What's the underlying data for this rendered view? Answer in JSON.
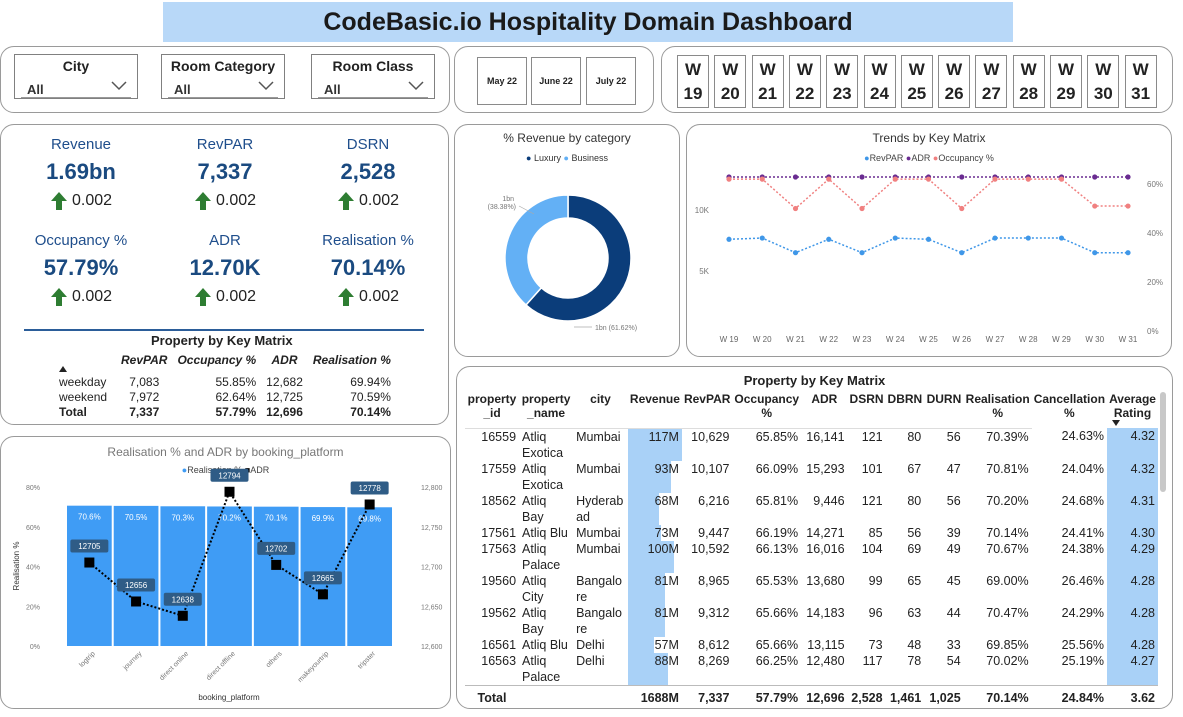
{
  "title": "CodeBasic.io  Hospitality Domain Dashboard",
  "slicers": [
    {
      "label": "City",
      "value": "All"
    },
    {
      "label": "Room Category",
      "value": "All"
    },
    {
      "label": "Room Class",
      "value": "All"
    }
  ],
  "months": [
    "May 22",
    "June 22",
    "July 22"
  ],
  "weeks": [
    {
      "w": "W",
      "n": "19"
    },
    {
      "w": "W",
      "n": "20"
    },
    {
      "w": "W",
      "n": "21"
    },
    {
      "w": "W",
      "n": "22"
    },
    {
      "w": "W",
      "n": "23"
    },
    {
      "w": "W",
      "n": "24"
    },
    {
      "w": "W",
      "n": "25"
    },
    {
      "w": "W",
      "n": "26"
    },
    {
      "w": "W",
      "n": "27"
    },
    {
      "w": "W",
      "n": "28"
    },
    {
      "w": "W",
      "n": "29"
    },
    {
      "w": "W",
      "n": "30"
    },
    {
      "w": "W",
      "n": "31"
    }
  ],
  "kpis": [
    {
      "label": "Revenue",
      "value": "1.69bn",
      "delta": "0.002"
    },
    {
      "label": "RevPAR",
      "value": "7,337",
      "delta": "0.002"
    },
    {
      "label": "DSRN",
      "value": "2,528",
      "delta": "0.002"
    },
    {
      "label": "Occupancy %",
      "value": "57.79%",
      "delta": "0.002"
    },
    {
      "label": "ADR",
      "value": "12.70K",
      "delta": "0.002"
    },
    {
      "label": "Realisation %",
      "value": "70.14%",
      "delta": "0.002"
    }
  ],
  "colors": {
    "accent": "#1f4e8c",
    "arrow": "#2e7d32",
    "luxury": "#0b3d7a",
    "business": "#63b0f5",
    "revpar": "#3f97e8",
    "adr": "#6a2c91",
    "occupancy": "#f08080",
    "bar": "#3f9cf5",
    "title_bg": "#b8d8f8"
  },
  "small_matrix": {
    "title": "Property by Key Matrix",
    "headers": [
      "RevPAR",
      "Occupancy %",
      "ADR",
      "Realisation %"
    ],
    "rows": [
      {
        "name": "weekday",
        "cells": [
          "7,083",
          "55.85%",
          "12,682",
          "69.94%"
        ]
      },
      {
        "name": "weekend",
        "cells": [
          "7,972",
          "62.64%",
          "12,725",
          "70.59%"
        ]
      }
    ],
    "total": {
      "name": "Total",
      "cells": [
        "7,337",
        "57.79%",
        "12,696",
        "70.14%"
      ]
    }
  },
  "donut": {
    "title": "% Revenue by category",
    "legend": [
      "Luxury",
      "Business"
    ],
    "label_business_1": "1bn",
    "label_business_2": "(38.38%)",
    "label_luxury": "1bn (61.62%)"
  },
  "trends": {
    "title": "Trends by Key Matrix",
    "legend": [
      "RevPAR",
      "ADR",
      "Occupancy %"
    ],
    "left_ticks": [
      "10K",
      "5K"
    ],
    "right_ticks": [
      "60%",
      "40%",
      "20%",
      "0%"
    ]
  },
  "platform_chart": {
    "title": "Realisation % and ADR by booking_platform",
    "legend": [
      "Realisation %",
      "ADR"
    ],
    "ylabel": "Realisation %",
    "xlabel": "booking_platform",
    "left_ticks": [
      "80%",
      "60%",
      "40%",
      "20%",
      "0%"
    ],
    "right_ticks": [
      "12,800",
      "12,750",
      "12,700",
      "12,650",
      "12,600"
    ]
  },
  "chart_data": [
    {
      "type": "pie",
      "title": "% Revenue by category",
      "categories": [
        "Luxury",
        "Business"
      ],
      "values": [
        61.62,
        38.38
      ]
    },
    {
      "type": "line",
      "title": "Trends by Key Matrix",
      "x": [
        "W 19",
        "W 20",
        "W 21",
        "W 22",
        "W 23",
        "W 24",
        "W 25",
        "W 26",
        "W 27",
        "W 28",
        "W 29",
        "W 30",
        "W 31"
      ],
      "series": [
        {
          "name": "RevPAR",
          "axis": "left",
          "values": [
            7600,
            7700,
            6500,
            7600,
            6500,
            7700,
            7600,
            6500,
            7700,
            7700,
            7700,
            6500,
            6500
          ]
        },
        {
          "name": "ADR",
          "axis": "left",
          "values": [
            12700,
            12700,
            12700,
            12700,
            12700,
            12700,
            12700,
            12700,
            12700,
            12700,
            12700,
            12700,
            12700
          ]
        },
        {
          "name": "Occupancy %",
          "axis": "right",
          "values": [
            62,
            62,
            50,
            62,
            50,
            62,
            62,
            50,
            62,
            62,
            62,
            51,
            51
          ]
        }
      ],
      "ylim_left": [
        0,
        14500
      ],
      "ylim_right": [
        0,
        65
      ],
      "grid": false,
      "legend": "top-center"
    },
    {
      "type": "bar",
      "title": "Realisation % and ADR by booking_platform",
      "categories": [
        "logtrip",
        "journey",
        "direct online",
        "direct offline",
        "others",
        "makeyourtrip",
        "tripster"
      ],
      "series": [
        {
          "name": "Realisation %",
          "type": "bar",
          "axis": "left",
          "values": [
            70.6,
            70.5,
            70.3,
            70.2,
            70.1,
            69.9,
            69.8
          ],
          "labels": [
            "70.6%",
            "70.5%",
            "70.3%",
            "70.2%",
            "70.1%",
            "69.9%",
            "69.8%"
          ]
        },
        {
          "name": "ADR",
          "type": "line",
          "axis": "right",
          "values": [
            12705,
            12656,
            12638,
            12794,
            12702,
            12665,
            12778
          ],
          "labels": [
            "12705",
            "12656",
            "12638",
            "12794",
            "12702",
            "12665",
            "12778"
          ]
        }
      ],
      "ylim_left": [
        0,
        80
      ],
      "ylim_right": [
        12600,
        12800
      ],
      "xlabel": "booking_platform",
      "ylabel": "Realisation %",
      "legend": "top-center"
    }
  ],
  "property_table": {
    "title": "Property by Key Matrix",
    "headers": [
      {
        "l1": "property",
        "l2": "_id"
      },
      {
        "l1": "property",
        "l2": "_name"
      },
      {
        "l1": "city",
        "l2": ""
      },
      {
        "l1": "Revenue",
        "l2": ""
      },
      {
        "l1": "RevPAR",
        "l2": ""
      },
      {
        "l1": "Occupancy",
        "l2": "%"
      },
      {
        "l1": "ADR",
        "l2": ""
      },
      {
        "l1": "DSRN",
        "l2": ""
      },
      {
        "l1": "DBRN",
        "l2": ""
      },
      {
        "l1": "DURN",
        "l2": ""
      },
      {
        "l1": "Realisation",
        "l2": "%"
      },
      {
        "l1": "Cancellation",
        "l2": "%"
      },
      {
        "l1": "Average",
        "l2": "Rating"
      }
    ],
    "rows": [
      {
        "id": "16559",
        "name1": "Atliq",
        "name2": "Exotica",
        "city1": "Mumbai",
        "city2": "",
        "revenue": "117M",
        "rev_pct": 100,
        "revpar": "10,629",
        "occ": "65.85%",
        "adr": "16,141",
        "dsrn": "121",
        "dbrn": "80",
        "durn": "56",
        "real": "70.39%",
        "canc": "24.63%",
        "rating": "4.32"
      },
      {
        "id": "17559",
        "name1": "Atliq",
        "name2": "Exotica",
        "city1": "Mumbai",
        "city2": "",
        "revenue": "93M",
        "rev_pct": 79,
        "revpar": "10,107",
        "occ": "66.09%",
        "adr": "15,293",
        "dsrn": "101",
        "dbrn": "67",
        "durn": "47",
        "real": "70.81%",
        "canc": "24.04%",
        "rating": "4.32"
      },
      {
        "id": "18562",
        "name1": "Atliq",
        "name2": "Bay",
        "city1": "Hyderab",
        "city2": "ad",
        "revenue": "68M",
        "rev_pct": 58,
        "revpar": "6,216",
        "occ": "65.81%",
        "adr": "9,446",
        "dsrn": "121",
        "dbrn": "80",
        "durn": "56",
        "real": "70.20%",
        "canc": "24.68%",
        "rating": "4.31"
      },
      {
        "id": "17561",
        "name1": "Atliq Blu",
        "name2": "",
        "city1": "Mumbai",
        "city2": "",
        "revenue": "73M",
        "rev_pct": 62,
        "revpar": "9,447",
        "occ": "66.19%",
        "adr": "14,271",
        "dsrn": "85",
        "dbrn": "56",
        "durn": "39",
        "real": "70.14%",
        "canc": "24.41%",
        "rating": "4.30"
      },
      {
        "id": "17563",
        "name1": "Atliq",
        "name2": "Palace",
        "city1": "Mumbai",
        "city2": "",
        "revenue": "100M",
        "rev_pct": 85,
        "revpar": "10,592",
        "occ": "66.13%",
        "adr": "16,016",
        "dsrn": "104",
        "dbrn": "69",
        "durn": "49",
        "real": "70.67%",
        "canc": "24.38%",
        "rating": "4.29"
      },
      {
        "id": "19560",
        "name1": "Atliq",
        "name2": "City",
        "city1": "Bangalo",
        "city2": "re",
        "revenue": "81M",
        "rev_pct": 69,
        "revpar": "8,965",
        "occ": "65.53%",
        "adr": "13,680",
        "dsrn": "99",
        "dbrn": "65",
        "durn": "45",
        "real": "69.00%",
        "canc": "26.46%",
        "rating": "4.28"
      },
      {
        "id": "19562",
        "name1": "Atliq",
        "name2": "Bay",
        "city1": "Bangalo",
        "city2": "re",
        "revenue": "81M",
        "rev_pct": 69,
        "revpar": "9,312",
        "occ": "65.66%",
        "adr": "14,183",
        "dsrn": "96",
        "dbrn": "63",
        "durn": "44",
        "real": "70.47%",
        "canc": "24.29%",
        "rating": "4.28"
      },
      {
        "id": "16561",
        "name1": "Atliq Blu",
        "name2": "",
        "city1": "Delhi",
        "city2": "",
        "revenue": "57M",
        "rev_pct": 49,
        "revpar": "8,612",
        "occ": "65.66%",
        "adr": "13,115",
        "dsrn": "73",
        "dbrn": "48",
        "durn": "33",
        "real": "69.85%",
        "canc": "25.56%",
        "rating": "4.28"
      },
      {
        "id": "16563",
        "name1": "Atliq",
        "name2": "Palace",
        "city1": "Delhi",
        "city2": "",
        "revenue": "88M",
        "rev_pct": 75,
        "revpar": "8,269",
        "occ": "66.25%",
        "adr": "12,480",
        "dsrn": "117",
        "dbrn": "78",
        "durn": "54",
        "real": "70.02%",
        "canc": "25.19%",
        "rating": "4.27"
      }
    ],
    "total": {
      "label": "Total",
      "revenue": "1688M",
      "revpar": "7,337",
      "occ": "57.79%",
      "adr": "12,696",
      "dsrn": "2,528",
      "dbrn": "1,461",
      "durn": "1,025",
      "real": "70.14%",
      "canc": "24.84%",
      "rating": "3.62"
    }
  }
}
